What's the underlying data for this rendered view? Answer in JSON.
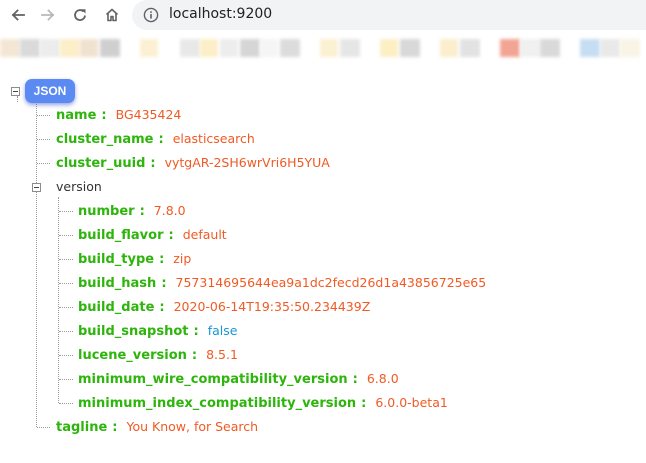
{
  "browser": {
    "url": "localhost:9200",
    "icons": {
      "back": "arrow-left-icon",
      "forward": "arrow-right-icon",
      "reload": "reload-icon",
      "home": "home-icon",
      "site_info": "info-icon"
    }
  },
  "viewer": {
    "root_label": "JSON",
    "colors": {
      "key": "#2db50c",
      "string": "#f15a24",
      "boolean": "#1a96d6",
      "badge": "#5a8af2"
    },
    "entries": [
      {
        "key": "name",
        "value": "BG435424"
      },
      {
        "key": "cluster_name",
        "value": "elasticsearch"
      },
      {
        "key": "cluster_uuid",
        "value": "vytgAR-2SH6wrVri6H5YUA"
      }
    ],
    "version": {
      "label": "version",
      "fields": [
        {
          "key": "number",
          "value": "7.8.0"
        },
        {
          "key": "build_flavor",
          "value": "default"
        },
        {
          "key": "build_type",
          "value": "zip"
        },
        {
          "key": "build_hash",
          "value": "757314695644ea9a1dc2fecd26d1a43856725e65"
        },
        {
          "key": "build_date",
          "value": "2020-06-14T19:35:50.234439Z"
        },
        {
          "key": "build_snapshot",
          "value": "false"
        },
        {
          "key": "lucene_version",
          "value": "8.5.1"
        },
        {
          "key": "minimum_wire_compatibility_version",
          "value": "6.8.0"
        },
        {
          "key": "minimum_index_compatibility_version",
          "value": "6.0.0-beta1"
        }
      ]
    },
    "tagline": {
      "key": "tagline",
      "value": "You Know, for Search"
    }
  }
}
